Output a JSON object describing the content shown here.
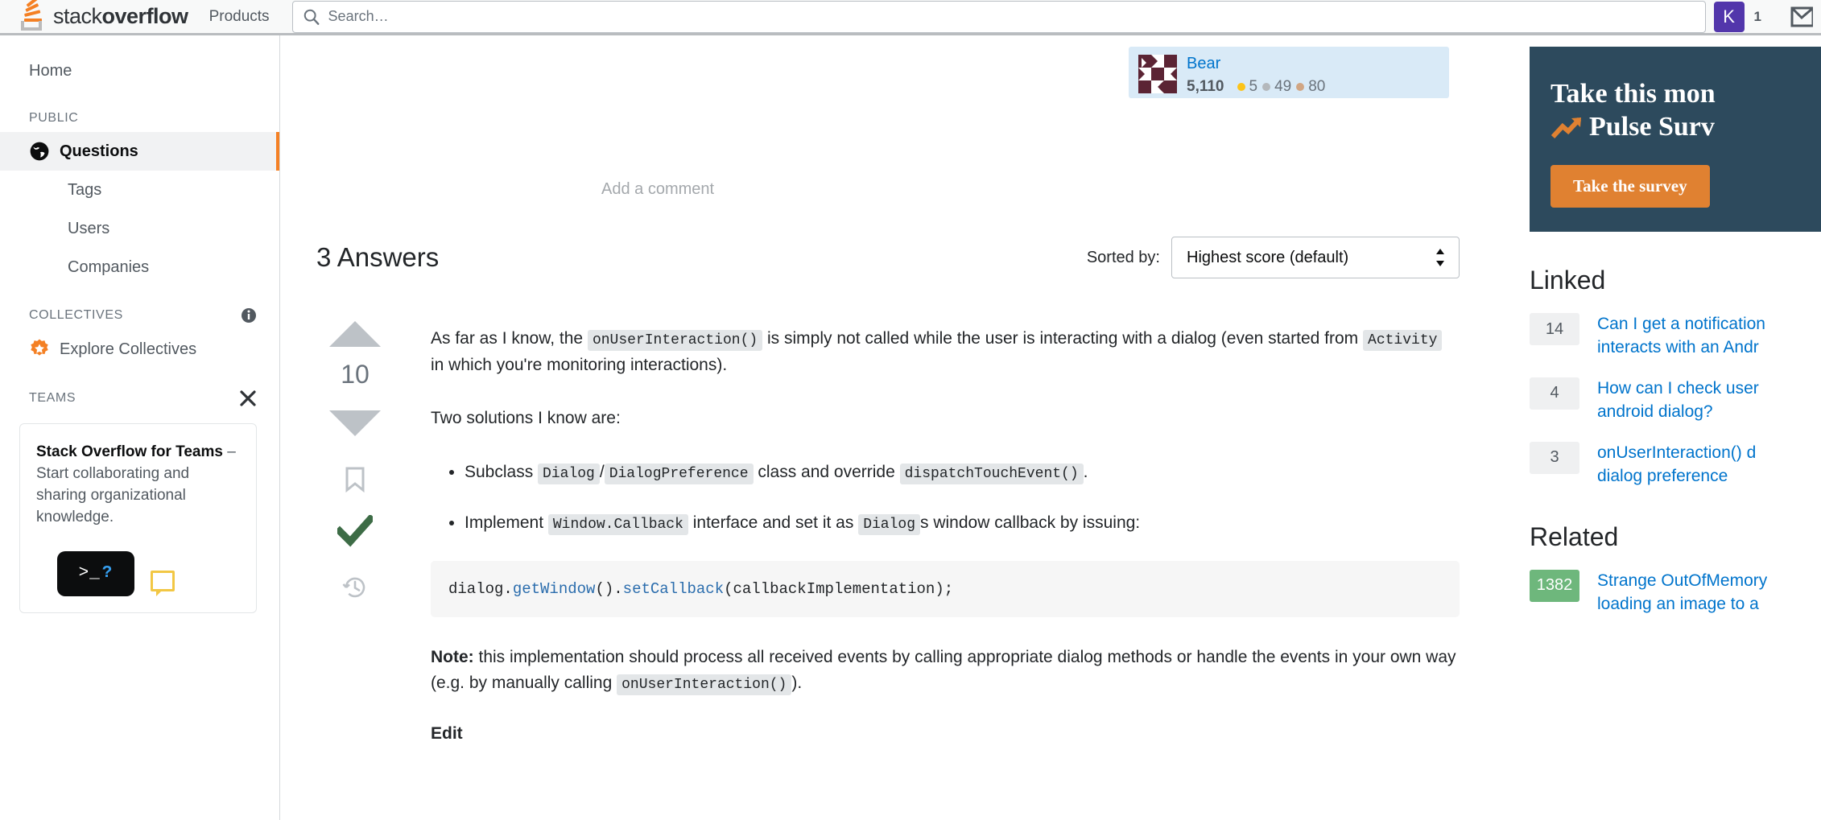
{
  "header": {
    "logo_stack": "stack",
    "logo_overflow": "overflow",
    "products_label": "Products",
    "search_placeholder": "Search…",
    "search_value": "",
    "user_initial": "K",
    "user_count": "1",
    "icons": {
      "search": "search-icon",
      "inbox": "inbox-icon"
    }
  },
  "sidebar": {
    "home_label": "Home",
    "public_heading": "PUBLIC",
    "public_items": [
      {
        "label": "Questions",
        "icon": "globe-icon",
        "active": true
      },
      {
        "label": "Tags",
        "icon": "",
        "active": false
      },
      {
        "label": "Users",
        "icon": "",
        "active": false
      },
      {
        "label": "Companies",
        "icon": "",
        "active": false
      }
    ],
    "collectives_heading": "COLLECTIVES",
    "collectives_item": "Explore Collectives",
    "teams_heading": "TEAMS",
    "teams_card": {
      "strong": "Stack Overflow for Teams",
      "rest": " – Start collaborating and sharing organizational knowledge.",
      "terminal_prompt": ">_",
      "terminal_q": "?"
    }
  },
  "main": {
    "usercard": {
      "name": "Bear",
      "reputation": "5,110",
      "gold": "5",
      "silver": "49",
      "bronze": "80"
    },
    "add_comment_label": "Add a comment",
    "answers_title": "3 Answers",
    "sorted_by_label": "Sorted by:",
    "sort_value": "Highest score (default)",
    "answer": {
      "score": "10",
      "p1_a": "As far as I know, the ",
      "p1_code1": "onUserInteraction()",
      "p1_b": " is simply not called while the user is interacting with a dialog (even started from ",
      "p1_code2": "Activity",
      "p1_c": " in which you're monitoring interactions).",
      "p2": "Two solutions I know are:",
      "li1_a": "Subclass ",
      "li1_code1": "Dialog",
      "li1_slash": "/",
      "li1_code2": "DialogPreference",
      "li1_b": " class and override ",
      "li1_code3": "dispatchTouchEvent()",
      "li1_c": ".",
      "li2_a": "Implement ",
      "li2_code1": "Window.Callback",
      "li2_b": " interface and set it as ",
      "li2_code2": "Dialog",
      "li2_c": "s window callback by issuing:",
      "code_block_pre": "dialog.",
      "code_block_fn1": "getWindow",
      "code_block_mid": "().",
      "code_block_fn2": "setCallback",
      "code_block_post": "(callbackImplementation);",
      "note_label": "Note:",
      "note_a": " this implementation should process all received events by calling appropriate dialog methods or handle the events in your own way (e.g. by manually calling ",
      "note_code": "onUserInteraction()",
      "note_b": ").",
      "edit_label": "Edit"
    }
  },
  "rightbar": {
    "promo": {
      "line1": "Take this mon",
      "line2": "Pulse Surv",
      "button": "Take the survey"
    },
    "linked_heading": "Linked",
    "linked": [
      {
        "score": "14",
        "title_l1": "Can I get a notification",
        "title_l2": "interacts with an Andr"
      },
      {
        "score": "4",
        "title_l1": "How can I check user",
        "title_l2": "android dialog?"
      },
      {
        "score": "3",
        "title_l1": "onUserInteraction() d",
        "title_l2": "dialog preference"
      }
    ],
    "related_heading": "Related",
    "related": [
      {
        "score": "1382",
        "title_l1": "Strange OutOfMemory",
        "title_l2": "loading an image to a"
      }
    ]
  }
}
